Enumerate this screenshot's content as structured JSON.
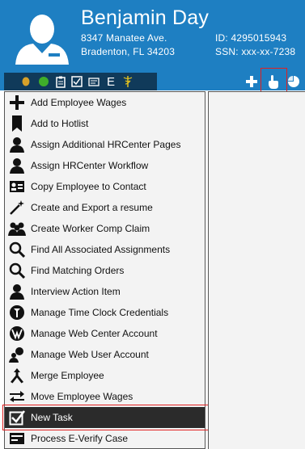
{
  "profile": {
    "name": "Benjamin Day",
    "address_line1": "8347 Manatee Ave.",
    "address_line2": "Bradenton, FL 34203",
    "id_text": "ID: 4295015943",
    "ssn_text": "SSN: xxx-xx-7238"
  },
  "toolbar": {
    "left_icons": [
      "coin-icon",
      "green-status-icon",
      "clipboard-icon",
      "checklist-icon",
      "id-card-icon",
      "letter-e-icon",
      "caduceus-icon"
    ],
    "right_icons": [
      "add-icon",
      "hand-pointer-icon",
      "pie-chart-icon"
    ],
    "e_glyph": "E"
  },
  "menu": {
    "items": [
      {
        "label": "Add Employee Wages",
        "icon": "plus-icon"
      },
      {
        "label": "Add to Hotlist",
        "icon": "bookmark-icon"
      },
      {
        "label": "Assign Additional HRCenter Pages",
        "icon": "person-icon"
      },
      {
        "label": "Assign HRCenter Workflow",
        "icon": "person-icon"
      },
      {
        "label": "Copy Employee to Contact",
        "icon": "contact-card-icon"
      },
      {
        "label": "Create and Export a resume",
        "icon": "magic-wand-icon"
      },
      {
        "label": "Create Worker Comp Claim",
        "icon": "group-icon"
      },
      {
        "label": "Find All Associated Assignments",
        "icon": "magnifier-icon"
      },
      {
        "label": "Find Matching Orders",
        "icon": "magnifier-icon"
      },
      {
        "label": "Interview Action Item",
        "icon": "person-icon"
      },
      {
        "label": "Manage Time Clock Credentials",
        "icon": "clock-icon"
      },
      {
        "label": "Manage Web Center Account",
        "icon": "web-account-icon"
      },
      {
        "label": "Manage Web User Account",
        "icon": "web-user-icon"
      },
      {
        "label": "Merge Employee",
        "icon": "merge-icon"
      },
      {
        "label": "Move Employee Wages",
        "icon": "transfer-icon"
      },
      {
        "label": "New Task",
        "icon": "checkbox-icon",
        "selected": true
      },
      {
        "label": "Process E-Verify Case",
        "icon": "card-icon"
      }
    ]
  },
  "colors": {
    "header_blue": "#1e7fc2",
    "toolbar_dark": "#103a5a",
    "selected_row": "#2b2b2b",
    "highlight_red": "#e02020"
  }
}
